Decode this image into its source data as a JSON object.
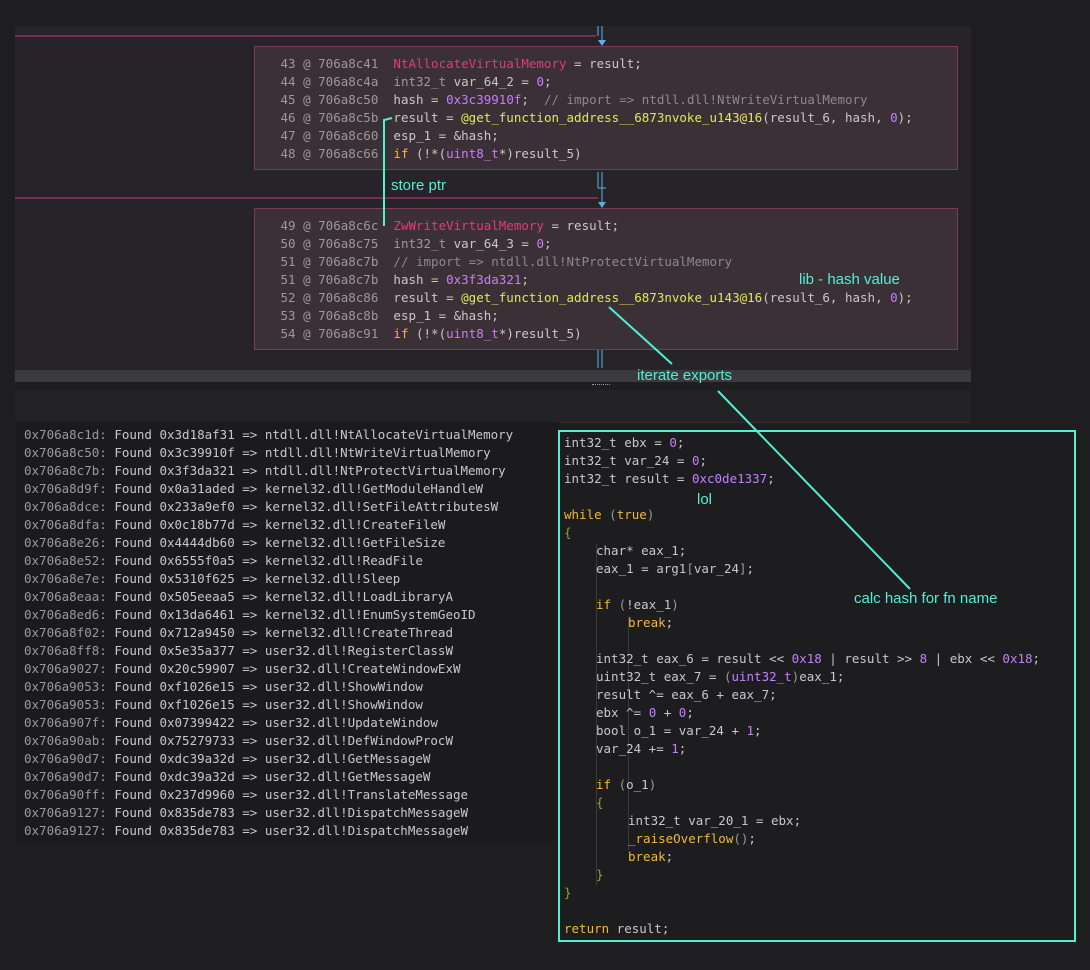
{
  "graph": {
    "block1": {
      "lines": [
        {
          "n": "43",
          "addr": "706a8c41",
          "parts": [
            [
              "fn",
              "NtAllocateVirtualMemory"
            ],
            [
              "code",
              " = result;"
            ]
          ]
        },
        {
          "n": "44",
          "addr": "706a8c4a",
          "parts": [
            [
              "typ",
              "int32_t "
            ],
            [
              "code",
              "var_64_2 = "
            ],
            [
              "num",
              "0"
            ],
            [
              "code",
              ";"
            ]
          ]
        },
        {
          "n": "45",
          "addr": "706a8c50",
          "parts": [
            [
              "code",
              "hash = "
            ],
            [
              "num",
              "0x3c39910f"
            ],
            [
              "code",
              ";  "
            ],
            [
              "cmt",
              "// import => ntdll.dll!NtWriteVirtualMemory"
            ]
          ]
        },
        {
          "n": "46",
          "addr": "706a8c5b",
          "parts": [
            [
              "code",
              "result = "
            ],
            [
              "cal",
              "@get_function_address__6873nvoke_u143@16"
            ],
            [
              "code",
              "(result_6, hash, "
            ],
            [
              "num",
              "0"
            ],
            [
              "code",
              ");"
            ]
          ]
        },
        {
          "n": "47",
          "addr": "706a8c60",
          "parts": [
            [
              "code",
              "esp_1 = &hash;"
            ]
          ]
        },
        {
          "n": "48",
          "addr": "706a8c66",
          "parts": [
            [
              "kw",
              "if"
            ],
            [
              "code",
              " (!*("
            ],
            [
              "num",
              "uint8_t"
            ],
            [
              "code",
              "*)result_5)"
            ]
          ]
        }
      ]
    },
    "block2": {
      "lines": [
        {
          "n": "49",
          "addr": "706a8c6c",
          "parts": [
            [
              "fn",
              "ZwWriteVirtualMemory"
            ],
            [
              "code",
              " = result;"
            ]
          ]
        },
        {
          "n": "50",
          "addr": "706a8c75",
          "parts": [
            [
              "typ",
              "int32_t "
            ],
            [
              "code",
              "var_64_3 = "
            ],
            [
              "num",
              "0"
            ],
            [
              "code",
              ";"
            ]
          ]
        },
        {
          "n": "51",
          "addr": "706a8c7b",
          "parts": [
            [
              "cmt",
              "// import => ntdll.dll!NtProtectVirtualMemory"
            ]
          ]
        },
        {
          "n": "51",
          "addr": "706a8c7b",
          "parts": [
            [
              "code",
              "hash = "
            ],
            [
              "num",
              "0x3f3da321"
            ],
            [
              "code",
              ";"
            ]
          ]
        },
        {
          "n": "52",
          "addr": "706a8c86",
          "parts": [
            [
              "code",
              "result = "
            ],
            [
              "cal",
              "@get_function_address__6873nvoke_u143@16"
            ],
            [
              "code",
              "(result_6, hash, "
            ],
            [
              "num",
              "0"
            ],
            [
              "code",
              ");"
            ]
          ]
        },
        {
          "n": "53",
          "addr": "706a8c8b",
          "parts": [
            [
              "code",
              "esp_1 = &hash;"
            ]
          ]
        },
        {
          "n": "54",
          "addr": "706a8c91",
          "parts": [
            [
              "kw",
              "if"
            ],
            [
              "code",
              " (!*("
            ],
            [
              "num",
              "uint8_t"
            ],
            [
              "code",
              "*)result_5)"
            ]
          ]
        }
      ]
    }
  },
  "annotations": {
    "store_ptr": "store ptr",
    "lib_hash": "lib - hash value",
    "iterate": "iterate exports",
    "lol": "lol",
    "calc": "calc hash for fn name"
  },
  "log": [
    [
      "0x706a8c1d:",
      " Found 0x3d18af31 => ntdll.dll!NtAllocateVirtualMemory"
    ],
    [
      "0x706a8c50:",
      " Found 0x3c39910f => ntdll.dll!NtWriteVirtualMemory"
    ],
    [
      "0x706a8c7b:",
      " Found 0x3f3da321 => ntdll.dll!NtProtectVirtualMemory"
    ],
    [
      "0x706a8d9f:",
      " Found 0x0a31aded => kernel32.dll!GetModuleHandleW"
    ],
    [
      "0x706a8dce:",
      " Found 0x233a9ef0 => kernel32.dll!SetFileAttributesW"
    ],
    [
      "0x706a8dfa:",
      " Found 0x0c18b77d => kernel32.dll!CreateFileW"
    ],
    [
      "0x706a8e26:",
      " Found 0x4444db60 => kernel32.dll!GetFileSize"
    ],
    [
      "0x706a8e52:",
      " Found 0x6555f0a5 => kernel32.dll!ReadFile"
    ],
    [
      "0x706a8e7e:",
      " Found 0x5310f625 => kernel32.dll!Sleep"
    ],
    [
      "0x706a8eaa:",
      " Found 0x505eeaa5 => kernel32.dll!LoadLibraryA"
    ],
    [
      "0x706a8ed6:",
      " Found 0x13da6461 => kernel32.dll!EnumSystemGeoID"
    ],
    [
      "0x706a8f02:",
      " Found 0x712a9450 => kernel32.dll!CreateThread"
    ],
    [
      "0x706a8ff8:",
      " Found 0x5e35a377 => user32.dll!RegisterClassW"
    ],
    [
      "0x706a9027:",
      " Found 0x20c59907 => user32.dll!CreateWindowExW"
    ],
    [
      "0x706a9053:",
      " Found 0xf1026e15 => user32.dll!ShowWindow"
    ],
    [
      "0x706a9053:",
      " Found 0xf1026e15 => user32.dll!ShowWindow"
    ],
    [
      "0x706a907f:",
      " Found 0x07399422 => user32.dll!UpdateWindow"
    ],
    [
      "0x706a90ab:",
      " Found 0x75279733 => user32.dll!DefWindowProcW"
    ],
    [
      "0x706a90d7:",
      " Found 0xdc39a32d => user32.dll!GetMessageW"
    ],
    [
      "0x706a90d7:",
      " Found 0xdc39a32d => user32.dll!GetMessageW"
    ],
    [
      "0x706a90ff:",
      " Found 0x237d9960 => user32.dll!TranslateMessage"
    ],
    [
      "0x706a9127:",
      " Found 0x835de783 => user32.dll!DispatchMessageW"
    ],
    [
      "0x706a9127:",
      " Found 0x835de783 => user32.dll!DispatchMessageW"
    ]
  ],
  "popup": [
    {
      "i": 0,
      "parts": [
        [
          "ptype",
          "int32_t ebx = "
        ],
        [
          "pnum",
          "0"
        ],
        [
          "ptype",
          ";"
        ]
      ]
    },
    {
      "i": 0,
      "parts": [
        [
          "ptype",
          "int32_t var_24 = "
        ],
        [
          "pnum",
          "0"
        ],
        [
          "ptype",
          ";"
        ]
      ]
    },
    {
      "i": 0,
      "parts": [
        [
          "ptype",
          "int32_t result = "
        ],
        [
          "pnum",
          "0xc0de1337"
        ],
        [
          "ptype",
          ";"
        ]
      ]
    },
    {
      "i": 0,
      "parts": []
    },
    {
      "i": 0,
      "parts": [
        [
          "pkw",
          "while"
        ],
        [
          "ptype",
          " "
        ],
        [
          "pgray",
          "("
        ],
        [
          "pkw",
          "true"
        ],
        [
          "pgray",
          ")"
        ]
      ]
    },
    {
      "i": 0,
      "parts": [
        [
          "pbrace",
          "{"
        ]
      ]
    },
    {
      "i": 1,
      "parts": [
        [
          "ptype",
          "char* eax_1;"
        ]
      ]
    },
    {
      "i": 1,
      "parts": [
        [
          "ptype",
          "eax_1 = arg1"
        ],
        [
          "pgray",
          "["
        ],
        [
          "ptype",
          "var_24"
        ],
        [
          "pgray",
          "]"
        ],
        [
          "ptype",
          ";"
        ]
      ]
    },
    {
      "i": 1,
      "parts": []
    },
    {
      "i": 1,
      "parts": [
        [
          "pkw",
          "if"
        ],
        [
          "ptype",
          " "
        ],
        [
          "pgray",
          "("
        ],
        [
          "ptype",
          "!eax_1"
        ],
        [
          "pgray",
          ")"
        ]
      ]
    },
    {
      "i": 2,
      "parts": [
        [
          "pkw",
          "break"
        ],
        [
          "ptype",
          ";"
        ]
      ]
    },
    {
      "i": 1,
      "parts": []
    },
    {
      "i": 1,
      "parts": [
        [
          "ptype",
          "int32_t eax_6 = result << "
        ],
        [
          "pnum",
          "0x18"
        ],
        [
          "ptype",
          " | result >> "
        ],
        [
          "pnum",
          "8"
        ],
        [
          "ptype",
          " | ebx << "
        ],
        [
          "pnum",
          "0x18"
        ],
        [
          "ptype",
          ";"
        ]
      ]
    },
    {
      "i": 1,
      "parts": [
        [
          "ptype",
          "uint32_t eax_7 = "
        ],
        [
          "pgray",
          "("
        ],
        [
          "pnum",
          "uint32_t"
        ],
        [
          "pgray",
          ")"
        ],
        [
          "ptype",
          "eax_1;"
        ]
      ]
    },
    {
      "i": 1,
      "parts": [
        [
          "ptype",
          "result ^= eax_6 + eax_7;"
        ]
      ]
    },
    {
      "i": 1,
      "parts": [
        [
          "ptype",
          "ebx ^= "
        ],
        [
          "pnum",
          "0"
        ],
        [
          "ptype",
          " + "
        ],
        [
          "pnum",
          "0"
        ],
        [
          "ptype",
          ";"
        ]
      ]
    },
    {
      "i": 1,
      "parts": [
        [
          "ptype",
          "bool o_1 = var_24 + "
        ],
        [
          "pnum",
          "1"
        ],
        [
          "ptype",
          ";"
        ]
      ]
    },
    {
      "i": 1,
      "parts": [
        [
          "ptype",
          "var_24 += "
        ],
        [
          "pnum",
          "1"
        ],
        [
          "ptype",
          ";"
        ]
      ]
    },
    {
      "i": 1,
      "parts": []
    },
    {
      "i": 1,
      "parts": [
        [
          "pkw",
          "if"
        ],
        [
          "ptype",
          " "
        ],
        [
          "pgray",
          "("
        ],
        [
          "ptype",
          "o_1"
        ],
        [
          "pgray",
          ")"
        ]
      ]
    },
    {
      "i": 1,
      "parts": [
        [
          "pbrace",
          "{"
        ]
      ]
    },
    {
      "i": 2,
      "parts": [
        [
          "ptype",
          "int32_t var_20_1 = ebx;"
        ]
      ]
    },
    {
      "i": 2,
      "parts": [
        [
          "pcall",
          "_raiseOverflow"
        ],
        [
          "pgray",
          "()"
        ],
        [
          "ptype",
          ";"
        ]
      ]
    },
    {
      "i": 2,
      "parts": [
        [
          "pkw",
          "break"
        ],
        [
          "ptype",
          ";"
        ]
      ]
    },
    {
      "i": 1,
      "parts": [
        [
          "pbrace",
          "}"
        ]
      ]
    },
    {
      "i": 0,
      "parts": [
        [
          "pbrace",
          "}"
        ]
      ]
    },
    {
      "i": 0,
      "parts": []
    },
    {
      "i": 0,
      "parts": [
        [
          "pkw",
          "return"
        ],
        [
          "ptype",
          " result;"
        ]
      ]
    }
  ]
}
